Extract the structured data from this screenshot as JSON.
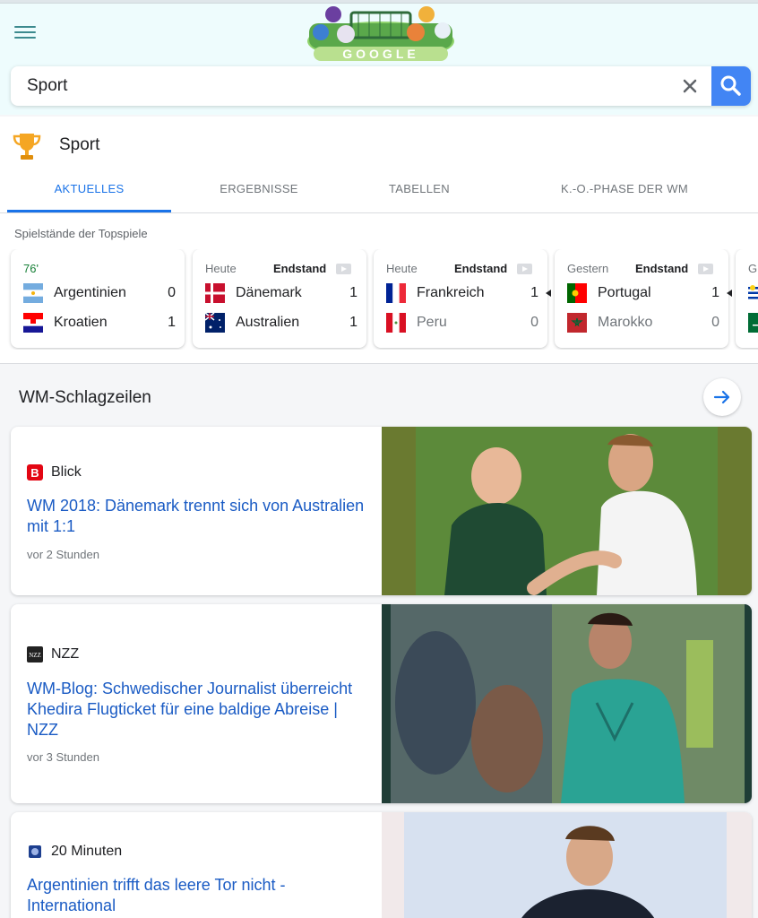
{
  "search": {
    "value": "Sport",
    "placeholder": ""
  },
  "sport": {
    "title": "Sport",
    "tabs": [
      {
        "label": "AKTUELLES",
        "active": true
      },
      {
        "label": "ERGEBNISSE",
        "active": false
      },
      {
        "label": "TABELLEN",
        "active": false
      },
      {
        "label": "K.-O.-PHASE DER WM",
        "active": false
      }
    ],
    "top_games_label": "Spielstände der Topspiele",
    "matches": [
      {
        "status": "76'",
        "result": "",
        "live": true,
        "home": {
          "name": "Argentinien",
          "score": "0",
          "flag": "argentina-flag"
        },
        "away": {
          "name": "Kroatien",
          "score": "1",
          "flag": "croatia-flag"
        }
      },
      {
        "status": "Heute",
        "result": "Endstand",
        "home": {
          "name": "Dänemark",
          "score": "1",
          "flag": "denmark-flag"
        },
        "away": {
          "name": "Australien",
          "score": "1",
          "flag": "australia-flag"
        }
      },
      {
        "status": "Heute",
        "result": "Endstand",
        "home": {
          "name": "Frankreich",
          "score": "1",
          "flag": "france-flag"
        },
        "away": {
          "name": "Peru",
          "score": "0",
          "flag": "peru-flag"
        }
      },
      {
        "status": "Gestern",
        "result": "Endstand",
        "home": {
          "name": "Portugal",
          "score": "1",
          "flag": "portugal-flag"
        },
        "away": {
          "name": "Marokko",
          "score": "0",
          "flag": "morocco-flag"
        }
      },
      {
        "status": "G",
        "result": "",
        "home": {
          "name": "",
          "score": "",
          "flag": "uruguay-flag"
        },
        "away": {
          "name": "",
          "score": "",
          "flag": "saudi-arabia-flag"
        }
      }
    ]
  },
  "headlines": {
    "title": "WM-Schlagzeilen",
    "articles": [
      {
        "source": "Blick",
        "source_icon": "blick-icon",
        "title": "WM 2018: Dänemark trennt sich von Australien mit 1:1",
        "time": "vor 2 Stunden"
      },
      {
        "source": "NZZ",
        "source_icon": "nzz-icon",
        "title": "WM-Blog: Schwedischer Journalist überreicht Khedira Flugticket für eine baldige Abreise | NZZ",
        "time": "vor 3 Stunden"
      },
      {
        "source": "20 Minuten",
        "source_icon": "20-minuten-icon",
        "title": "Argentinien trifft das leere Tor nicht - International",
        "time": ""
      }
    ]
  },
  "colors": {
    "accent": "#1a73e8",
    "search_button": "#4285f4",
    "link": "#1a5bc4",
    "live": "#188038",
    "header_bg": "#eefcfd"
  }
}
